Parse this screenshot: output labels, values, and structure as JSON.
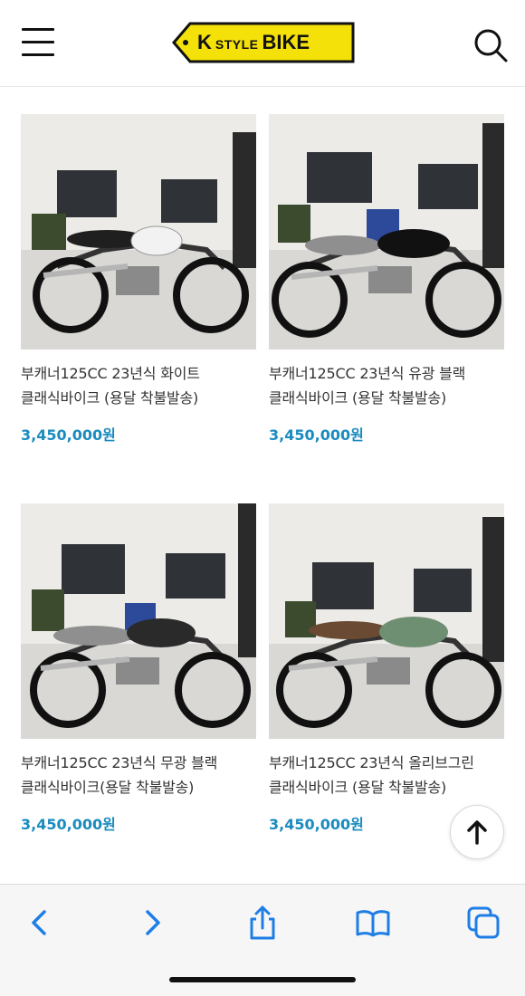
{
  "header": {
    "logo": {
      "k": "K",
      "style": "STYLE",
      "bike": "BIKE"
    },
    "menu_icon": "hamburger-menu-icon",
    "search_icon": "search-icon"
  },
  "products": [
    {
      "title": "부캐너125CC 23년식 화이트 클래식바이크 (용달 착불발송)",
      "price": "3,450,000원"
    },
    {
      "title": "부캐너125CC 23년식 유광 블랙 클래식바이크 (용달 착불발송)",
      "price": "3,450,000원"
    },
    {
      "title": "부캐너125CC 23년식 무광 블랙 클래식바이크(용달 착불발송)",
      "price": "3,450,000원"
    },
    {
      "title": "부캐너125CC 23년식 올리브그린 클래식바이크 (용달 착불발송)",
      "price": "3,450,000원"
    }
  ],
  "colors": {
    "accent_price": "#1a8bbf",
    "logo_yellow": "#f5e10a",
    "toolbar_blue": "#1f7ee6"
  },
  "browser_toolbar": {
    "icons": [
      "back-icon",
      "forward-icon",
      "share-icon",
      "bookmarks-icon",
      "tabs-icon"
    ]
  }
}
